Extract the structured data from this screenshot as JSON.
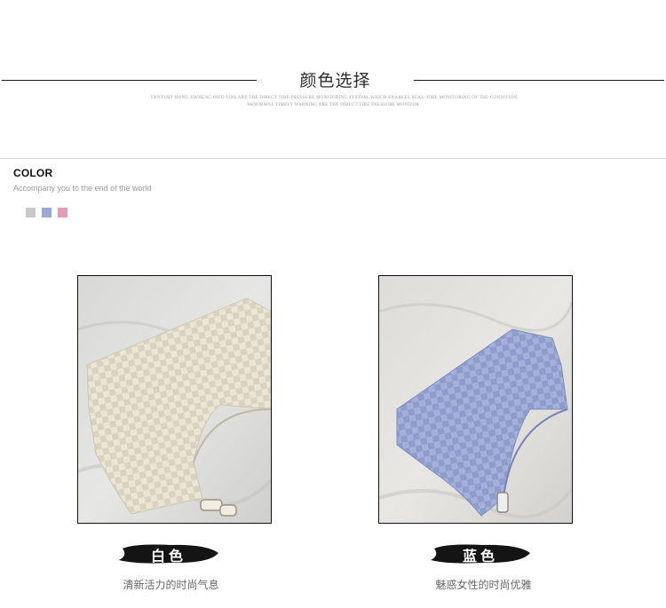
{
  "header": {
    "title": "颜色选择",
    "tiny_line_1": "Century Hong Jiwheng info tins are the direct tire pressure monitoring system, which enables real-time monitoring of the condition,",
    "tiny_line_2": "abnormal timely warning are the direct tire pressure monitor"
  },
  "color_section": {
    "label": "COLOR",
    "subtitle": "Accompany you to the end of the world",
    "swatches": [
      "#c9c9c9",
      "#9aa8d8",
      "#e79bb4"
    ]
  },
  "products": [
    {
      "name": "白色",
      "caption": "清新活力的时尚气息",
      "bag_color": "#ebe5d6",
      "accent": "#d9d2c0"
    },
    {
      "name": "蓝色",
      "caption": "魅惑女性的时尚优雅",
      "bag_color": "#a3b1da",
      "accent": "#8e9ccb"
    }
  ]
}
